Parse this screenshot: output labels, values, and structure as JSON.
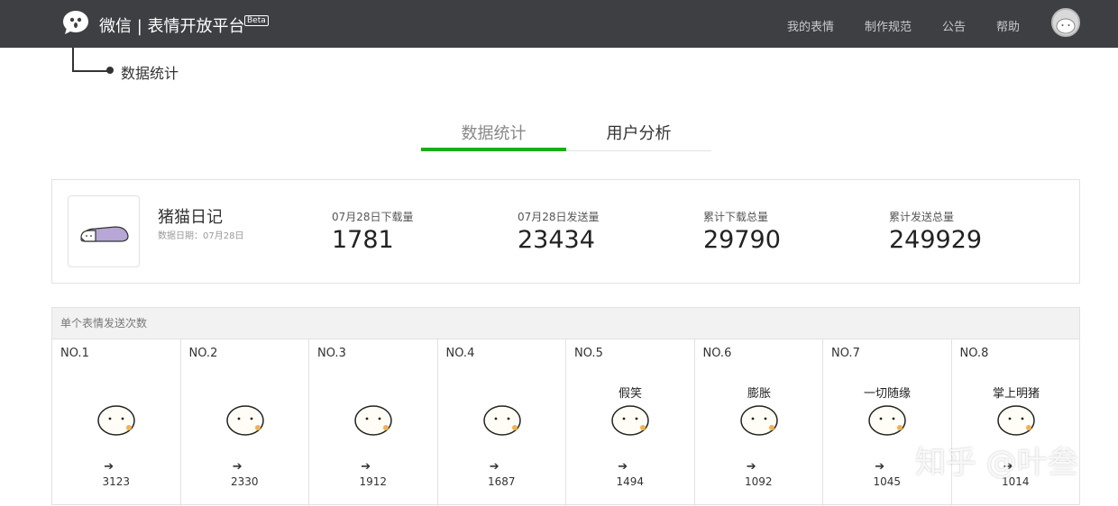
{
  "header": {
    "brand": "微信 | 表情开放平台",
    "beta": "Beta",
    "nav": [
      "我的表情",
      "制作规范",
      "公告",
      "帮助"
    ]
  },
  "breadcrumb": "数据统计",
  "tabs": [
    "数据统计",
    "用户分析"
  ],
  "summary": {
    "name": "猪猫日记",
    "date": "数据日期：07月28日",
    "stats": [
      {
        "label": "07月28日下载量",
        "value": "1781"
      },
      {
        "label": "07月28日发送量",
        "value": "23434"
      },
      {
        "label": "累计下载总量",
        "value": "29790"
      },
      {
        "label": "累计发送总量",
        "value": "249929"
      }
    ]
  },
  "ranking": {
    "title": "单个表情发送次数",
    "items": [
      {
        "no": "NO.1",
        "count": "3123",
        "caption": ""
      },
      {
        "no": "NO.2",
        "count": "2330",
        "caption": ""
      },
      {
        "no": "NO.3",
        "count": "1912",
        "caption": ""
      },
      {
        "no": "NO.4",
        "count": "1687",
        "caption": ""
      },
      {
        "no": "NO.5",
        "count": "1494",
        "caption": "假笑"
      },
      {
        "no": "NO.6",
        "count": "1092",
        "caption": "膨胀"
      },
      {
        "no": "NO.7",
        "count": "1045",
        "caption": "一切随缘"
      },
      {
        "no": "NO.8",
        "count": "1014",
        "caption": "掌上明猪"
      }
    ]
  },
  "arrow": "➔",
  "watermark": "知乎 @叶叁",
  "colors": {
    "accent": "#1aad19",
    "header_bg": "#3d3f43"
  }
}
